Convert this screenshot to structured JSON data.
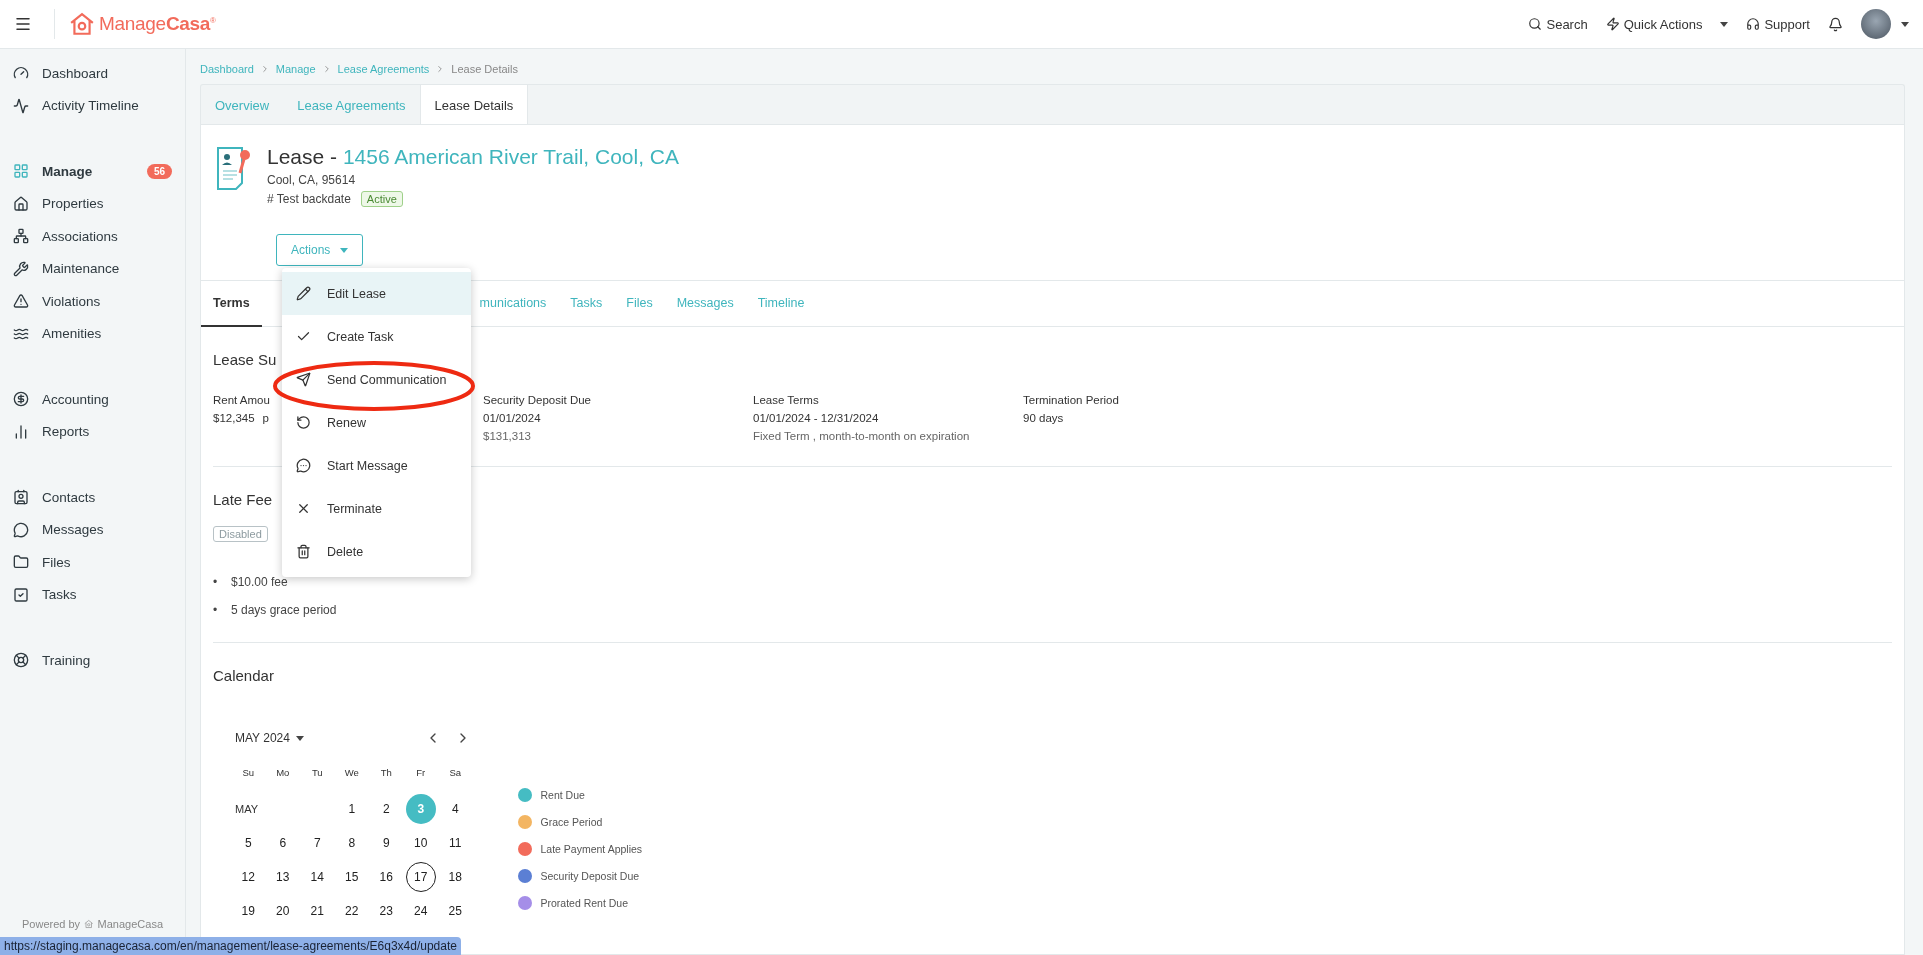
{
  "topbar": {
    "logo": {
      "part_1": "Manage",
      "part_2": "Casa",
      "mark": "®"
    },
    "actions": [
      {
        "label": "Search"
      },
      {
        "label": "Quick Actions"
      },
      {
        "label": "Support"
      }
    ]
  },
  "sidebar": {
    "groups": [
      {
        "items": [
          {
            "label": "Dashboard",
            "selected": false
          },
          {
            "label": "Activity Timeline",
            "selected": false
          }
        ]
      },
      {
        "items": [
          {
            "label": "Manage",
            "selected": true,
            "badge": "56"
          },
          {
            "label": "Properties",
            "selected": false
          },
          {
            "label": "Associations",
            "selected": false
          },
          {
            "label": "Maintenance",
            "selected": false
          },
          {
            "label": "Violations",
            "selected": false
          },
          {
            "label": "Amenities",
            "selected": false
          }
        ]
      },
      {
        "items": [
          {
            "label": "Accounting",
            "selected": false
          },
          {
            "label": "Reports",
            "selected": false
          }
        ]
      },
      {
        "items": [
          {
            "label": "Contacts",
            "selected": false
          },
          {
            "label": "Messages",
            "selected": false
          },
          {
            "label": "Files",
            "selected": false
          },
          {
            "label": "Tasks",
            "selected": false
          }
        ]
      },
      {
        "items": [
          {
            "label": "Training",
            "selected": false
          }
        ]
      }
    ],
    "footer": {
      "prefix": "Powered by",
      "brand": "ManageCasa"
    }
  },
  "breadcrumb": [
    "Dashboard",
    "Manage",
    "Lease Agreements",
    "Lease Details"
  ],
  "page_tabs": [
    {
      "label": "Overview",
      "selected": false
    },
    {
      "label": "Lease Agreements",
      "selected": false
    },
    {
      "label": "Lease Details",
      "selected": true
    }
  ],
  "lease": {
    "title_prefix": "Lease -",
    "title_link": "1456 American River Trail, Cool, CA",
    "address": "Cool, CA, 95614",
    "reference": "# Test backdate",
    "status": "Active",
    "actions_button": "Actions"
  },
  "actions_menu": [
    {
      "label": "Edit Lease",
      "selected": true
    },
    {
      "label": "Create Task",
      "selected": false
    },
    {
      "label": "Send Communication",
      "selected": false
    },
    {
      "label": "Renew",
      "selected": false
    },
    {
      "label": "Start Message",
      "selected": false
    },
    {
      "label": "Terminate",
      "selected": false
    },
    {
      "label": "Delete",
      "selected": false
    }
  ],
  "detail_tabs": [
    {
      "label": "Terms",
      "selected": true
    },
    {
      "label": "munications",
      "selected": false
    },
    {
      "label": "Tasks",
      "selected": false
    },
    {
      "label": "Files",
      "selected": false
    },
    {
      "label": "Messages",
      "selected": false
    },
    {
      "label": "Timeline",
      "selected": false
    }
  ],
  "lease_summary": {
    "heading": "Lease Su",
    "columns": [
      {
        "label": "Rent Amou",
        "value": "$12,345",
        "extra": "p"
      },
      {
        "label": "Security Deposit Due",
        "value": "01/01/2024",
        "note": "$131,313"
      },
      {
        "label": "Lease Terms",
        "value": "01/01/2024 - 12/31/2024",
        "note": "Fixed Term , month-to-month on expiration"
      },
      {
        "label": "Termination Period",
        "value": "90 days"
      }
    ]
  },
  "late_fees": {
    "heading": "Late Fee",
    "status": "Disabled",
    "bullets": [
      {
        "marker": "•",
        "text": "$10.00 fee"
      },
      {
        "marker": "•",
        "text": "5 days grace period"
      }
    ]
  },
  "calendar": {
    "heading": "Calendar",
    "month": "MAY 2024",
    "weekdays": [
      "Su",
      "Mo",
      "Tu",
      "We",
      "Th",
      "Fr",
      "Sa"
    ],
    "weeks": [
      {
        "label": "MAY",
        "days": [
          {
            "day": "1",
            "selected": false,
            "today": false
          },
          {
            "day": "2",
            "selected": false,
            "today": false
          },
          {
            "day": "3",
            "selected": true,
            "today": false
          },
          {
            "day": "4",
            "selected": false,
            "today": false
          }
        ]
      },
      {
        "days": [
          {
            "day": "5",
            "selected": false,
            "today": false
          },
          {
            "day": "6",
            "selected": false,
            "today": false
          },
          {
            "day": "7",
            "selected": false,
            "today": false
          },
          {
            "day": "8",
            "selected": false,
            "today": false
          },
          {
            "day": "9",
            "selected": false,
            "today": false
          },
          {
            "day": "10",
            "selected": false,
            "today": false
          },
          {
            "day": "11",
            "selected": false,
            "today": false
          }
        ]
      },
      {
        "days": [
          {
            "day": "12",
            "selected": false,
            "today": false
          },
          {
            "day": "13",
            "selected": false,
            "today": false
          },
          {
            "day": "14",
            "selected": false,
            "today": false
          },
          {
            "day": "15",
            "selected": false,
            "today": false
          },
          {
            "day": "16",
            "selected": false,
            "today": false
          },
          {
            "day": "17",
            "selected": false,
            "today": true
          },
          {
            "day": "18",
            "selected": false,
            "today": false
          }
        ]
      },
      {
        "days": [
          {
            "day": "19",
            "selected": false,
            "today": false
          },
          {
            "day": "20",
            "selected": false,
            "today": false
          },
          {
            "day": "21",
            "selected": false,
            "today": false
          },
          {
            "day": "22",
            "selected": false,
            "today": false
          },
          {
            "day": "23",
            "selected": false,
            "today": false
          },
          {
            "day": "24",
            "selected": false,
            "today": false
          },
          {
            "day": "25",
            "selected": false,
            "today": false
          }
        ]
      }
    ],
    "legend": [
      {
        "label": "Rent Due",
        "color": "#45bcc3"
      },
      {
        "label": "Grace Period",
        "color": "#f3b562"
      },
      {
        "label": "Late Payment Applies",
        "color": "#f26b5b"
      },
      {
        "label": "Security Deposit Due",
        "color": "#5b7fd4"
      },
      {
        "label": "Prorated Rent Due",
        "color": "#a58ee8"
      }
    ]
  },
  "status_url": "https://staging.managecasa.com/en/management/lease-agreements/E6q3x4d/update"
}
